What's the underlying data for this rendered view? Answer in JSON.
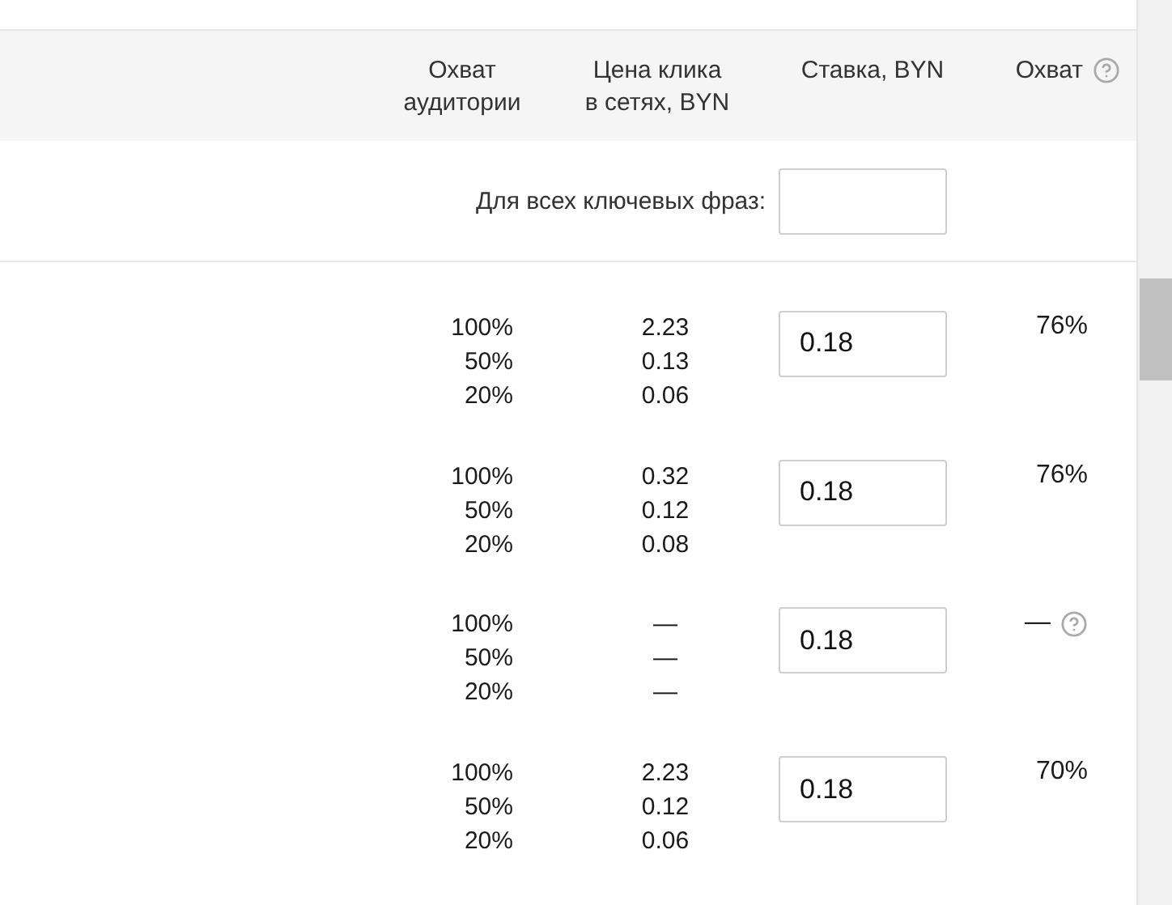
{
  "columns": [
    {
      "label": "Охват аудитории",
      "help": false
    },
    {
      "label": "Цена клика в сетях, BYN",
      "help": false
    },
    {
      "label": "Ставка, BYN",
      "help": false
    },
    {
      "label": "Охват",
      "help": true
    }
  ],
  "all_phrases": {
    "label": "Для всех ключевых фраз:"
  },
  "rows": [
    {
      "coverage": [
        "100%",
        "50%",
        "20%"
      ],
      "prices": [
        "2.23",
        "0.13",
        "0.06"
      ],
      "bid": "0.18",
      "reach": "76%",
      "help": false
    },
    {
      "coverage": [
        "100%",
        "50%",
        "20%"
      ],
      "prices": [
        "0.32",
        "0.12",
        "0.08"
      ],
      "bid": "0.18",
      "reach": "76%",
      "help": false
    },
    {
      "coverage": [
        "100%",
        "50%",
        "20%"
      ],
      "prices": [
        "—",
        "—",
        "—"
      ],
      "bid": "0.18",
      "reach": "—",
      "help": true
    },
    {
      "coverage": [
        "100%",
        "50%",
        "20%"
      ],
      "prices": [
        "2.23",
        "0.12",
        "0.06"
      ],
      "bid": "0.18",
      "reach": "70%",
      "help": false
    }
  ]
}
